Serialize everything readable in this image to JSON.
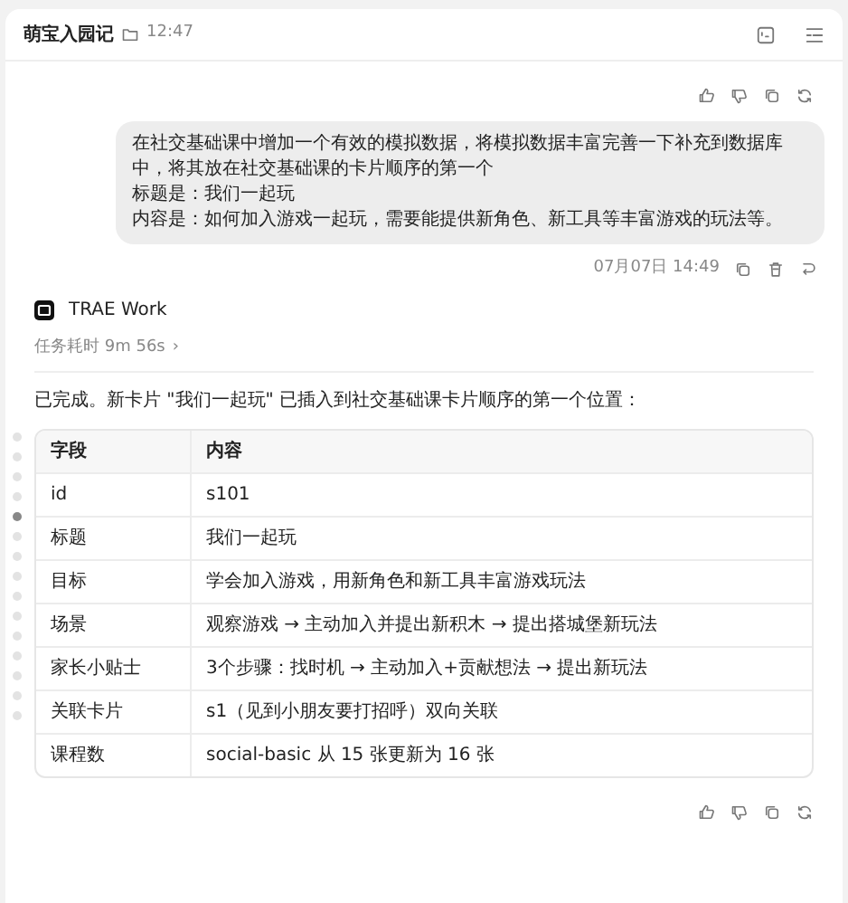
{
  "header": {
    "title": "萌宝入园记",
    "time": "12:47"
  },
  "user_message": {
    "lines": [
      "在社交基础课中增加一个有效的模拟数据，将模拟数据丰富完善一下补充到数据库中，将其放在社交基础课的卡片顺序的第一个",
      "标题是：我们一起玩",
      "内容是：如何加入游戏一起玩，需要能提供新角色、新工具等丰富游戏的玩法等。"
    ],
    "timestamp": "07月07日 14:49"
  },
  "assistant": {
    "name": "TRAE Work",
    "duration": "任务耗时 9m 56s",
    "chevron": "›",
    "summary": "已完成。新卡片 \"我们一起玩\" 已插入到社交基础课卡片顺序的第一个位置：",
    "table": {
      "columns": [
        "字段",
        "内容"
      ],
      "rows": [
        [
          "id",
          "s101"
        ],
        [
          "标题",
          "我们一起玩"
        ],
        [
          "目标",
          "学会加入游戏，用新角色和新工具丰富游戏玩法"
        ],
        [
          "场景",
          "观察游戏 → 主动加入并提出新积木 → 提出搭城堡新玩法"
        ],
        [
          "家长小贴士",
          "3个步骤：找时机 → 主动加入+贡献想法 → 提出新玩法"
        ],
        [
          "关联卡片",
          "s1（见到小朋友要打招呼）双向关联"
        ],
        [
          "课程数",
          "social-basic 从 15 张更新为 16 张"
        ]
      ]
    }
  },
  "timeline_dots": [
    {
      "selected": false
    },
    {
      "selected": false
    },
    {
      "selected": false
    },
    {
      "selected": false
    },
    {
      "selected": true
    },
    {
      "selected": false
    },
    {
      "selected": false
    },
    {
      "selected": false
    },
    {
      "selected": false
    },
    {
      "selected": false
    },
    {
      "selected": false
    },
    {
      "selected": false
    },
    {
      "selected": false
    },
    {
      "selected": false
    },
    {
      "selected": false
    }
  ]
}
